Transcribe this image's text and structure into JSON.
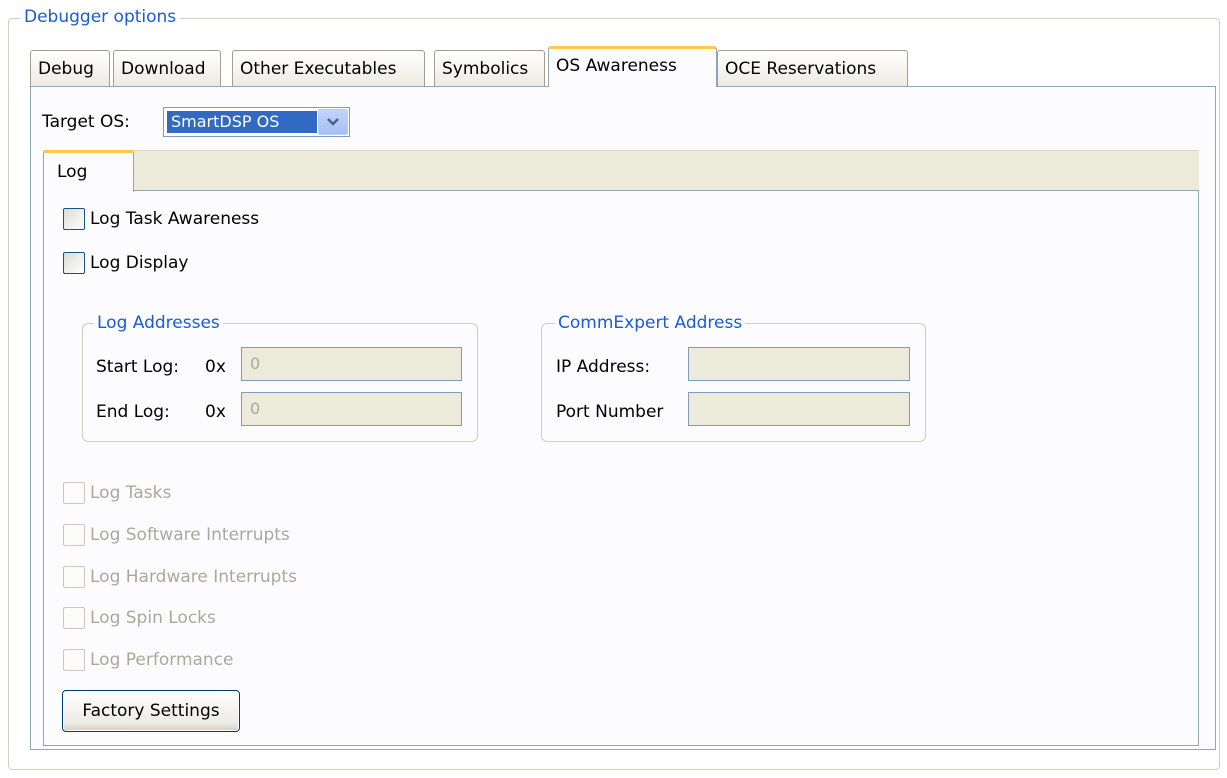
{
  "group": {
    "title": "Debugger options"
  },
  "tabs": [
    {
      "label": "Debug"
    },
    {
      "label": "Download"
    },
    {
      "label": "Other Executables"
    },
    {
      "label": "Symbolics"
    },
    {
      "label": "OS Awareness",
      "active": true
    },
    {
      "label": "OCE Reservations"
    }
  ],
  "target_os": {
    "label": "Target OS:",
    "value": "SmartDSP OS"
  },
  "inner_tabs": [
    {
      "label": "Log",
      "active": true
    }
  ],
  "checkboxes": {
    "log_task_awareness": {
      "label": "Log Task Awareness",
      "checked": false
    },
    "log_display": {
      "label": "Log Display",
      "checked": false
    }
  },
  "log_addresses": {
    "title": "Log Addresses",
    "start_label": "Start Log:",
    "end_label": "End Log:",
    "prefix": "0x",
    "start_value": "0",
    "end_value": "0"
  },
  "commexpert": {
    "title": "CommExpert Address",
    "ip_label": "IP Address:",
    "port_label": "Port Number",
    "ip_value": "",
    "port_value": ""
  },
  "disabled_checkboxes": [
    {
      "label": "Log Tasks"
    },
    {
      "label": "Log Software Interrupts"
    },
    {
      "label": "Log Hardware Interrupts"
    },
    {
      "label": "Log Spin Locks"
    },
    {
      "label": "Log Performance"
    }
  ],
  "factory_button": {
    "label": "Factory Settings"
  },
  "colors": {
    "legend_text": "#1a5bd6",
    "tab_highlight": "#ffc84a",
    "selection": "#316ac5",
    "disabled_text": "#aca899"
  },
  "icons": {
    "dropdown": "chevron-down-icon"
  }
}
